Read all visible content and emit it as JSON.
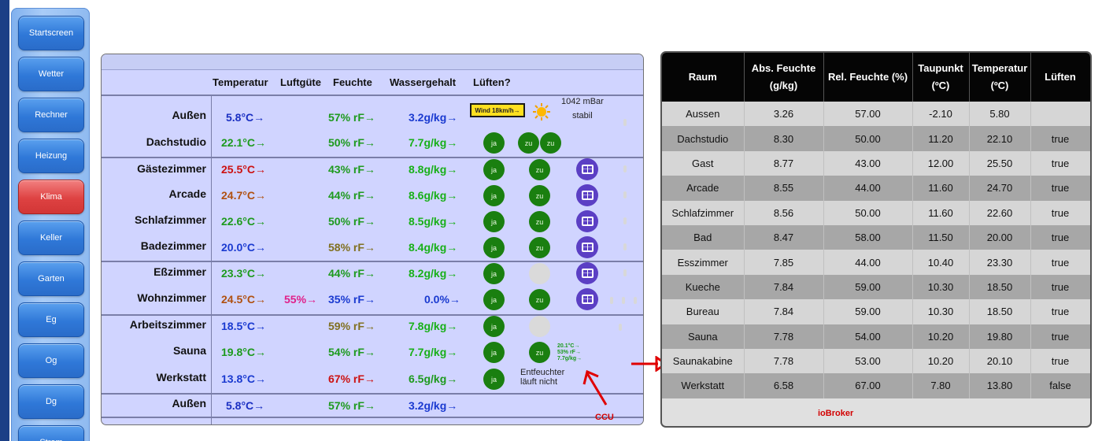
{
  "sidebar": {
    "items": [
      {
        "label": "Startscreen",
        "active": false
      },
      {
        "label": "Wetter",
        "active": false
      },
      {
        "label": "Rechner",
        "active": false
      },
      {
        "label": "Heizung",
        "active": false
      },
      {
        "label": "Klima",
        "active": true
      },
      {
        "label": "Keller",
        "active": false
      },
      {
        "label": "Garten",
        "active": false
      },
      {
        "label": "Eg",
        "active": false
      },
      {
        "label": "Og",
        "active": false
      },
      {
        "label": "Dg",
        "active": false
      },
      {
        "label": "Strom",
        "active": false
      }
    ]
  },
  "climate": {
    "headers": {
      "temp": "Temperatur",
      "air": "Luftgüte",
      "humidity": "Feuchte",
      "water": "Wassergehalt",
      "vent": "Lüften?"
    },
    "weather": {
      "wind": "Wind 18km/h→",
      "pressure": "1042 mBar",
      "trend": "stabil",
      "icon": "sun-icon"
    },
    "rows": [
      {
        "name": "Außen",
        "temp": "5.8°C→",
        "hum": "57% rF→",
        "water": "3.2g/kg→"
      },
      {
        "name": "Dachstudio",
        "temp": "22.1°C→",
        "hum": "50% rF→",
        "water": "7.7g/kg→",
        "b1": "ja",
        "b2": "zu",
        "b3": "zu"
      },
      {
        "name": "Gästezimmer",
        "temp": "25.5°C→",
        "hum": "43% rF→",
        "water": "8.8g/kg→",
        "b1": "ja",
        "b2": "zu"
      },
      {
        "name": "Arcade",
        "temp": "24.7°C→",
        "hum": "44% rF→",
        "water": "8.6g/kg→",
        "b1": "ja",
        "b2": "zu"
      },
      {
        "name": "Schlafzimmer",
        "temp": "22.6°C→",
        "hum": "50% rF→",
        "water": "8.5g/kg→",
        "b1": "ja",
        "b2": "zu"
      },
      {
        "name": "Badezimmer",
        "temp": "20.0°C→",
        "hum": "58% rF→",
        "water": "8.4g/kg→",
        "b1": "ja",
        "b2": "zu"
      },
      {
        "name": "Eßzimmer",
        "temp": "23.3°C→",
        "hum": "44% rF→",
        "water": "8.2g/kg→",
        "b1": "ja"
      },
      {
        "name": "Wohnzimmer",
        "temp": "24.5°C→",
        "air": "55%→",
        "hum": "35% rF→",
        "water": "0.0%→",
        "b1": "ja",
        "b2": "zu"
      },
      {
        "name": "Arbeitszimmer",
        "temp": "18.5°C→",
        "hum": "59% rF→",
        "water": "7.8g/kg→",
        "b1": "ja"
      },
      {
        "name": "Sauna",
        "temp": "19.8°C→",
        "hum": "54% rF→",
        "water": "7.7g/kg→",
        "b1": "ja",
        "b2": "zu"
      },
      {
        "name": "Werkstatt",
        "temp": "13.8°C→",
        "hum": "67% rF→",
        "water": "6.5g/kg→",
        "b1": "ja"
      },
      {
        "name": "Außen",
        "temp": "5.8°C→",
        "hum": "57% rF→",
        "water": "3.2g/kg→"
      }
    ],
    "sauna_mini": [
      "20.1°C→",
      "53% rF→",
      "7.7g/kg→"
    ],
    "dehumidifier": [
      "Entfeuchter",
      "läuft nicht"
    ],
    "ccu_label": "CCU"
  },
  "iobroker": {
    "headers": [
      [
        "Raum"
      ],
      [
        "Abs. Feuchte",
        "(g/kg)"
      ],
      [
        "Rel. Feuchte (%)"
      ],
      [
        "Taupunkt",
        "(ºC)"
      ],
      [
        "Temperatur",
        "(ºC)"
      ],
      [
        "Lüften"
      ]
    ],
    "rows": [
      [
        "Aussen",
        "3.26",
        "57.00",
        "-2.10",
        "5.80",
        ""
      ],
      [
        "Dachstudio",
        "8.30",
        "50.00",
        "11.20",
        "22.10",
        "true"
      ],
      [
        "Gast",
        "8.77",
        "43.00",
        "12.00",
        "25.50",
        "true"
      ],
      [
        "Arcade",
        "8.55",
        "44.00",
        "11.60",
        "24.70",
        "true"
      ],
      [
        "Schlafzimmer",
        "8.56",
        "50.00",
        "11.60",
        "22.60",
        "true"
      ],
      [
        "Bad",
        "8.47",
        "58.00",
        "11.50",
        "20.00",
        "true"
      ],
      [
        "Esszimmer",
        "7.85",
        "44.00",
        "10.40",
        "23.30",
        "true"
      ],
      [
        "Kueche",
        "7.84",
        "59.00",
        "10.30",
        "18.50",
        "true"
      ],
      [
        "Bureau",
        "7.84",
        "59.00",
        "10.30",
        "18.50",
        "true"
      ],
      [
        "Sauna",
        "7.78",
        "54.00",
        "10.20",
        "19.80",
        "true"
      ],
      [
        "Saunakabine",
        "7.78",
        "53.00",
        "10.20",
        "20.10",
        "true"
      ],
      [
        "Werkstatt",
        "6.58",
        "67.00",
        "7.80",
        "13.80",
        "false"
      ]
    ],
    "footer": "ioBroker"
  }
}
